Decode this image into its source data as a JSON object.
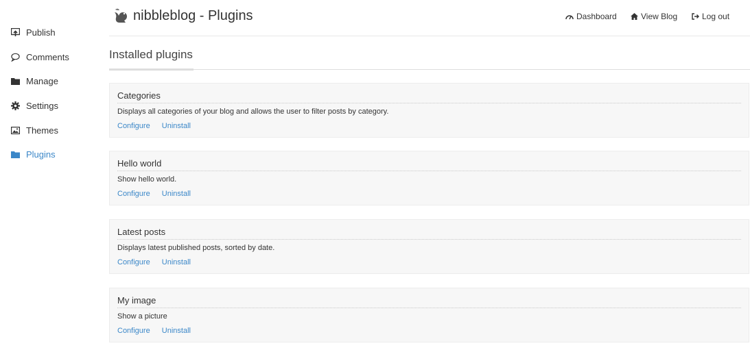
{
  "app": {
    "title": "nibbleblog - Plugins"
  },
  "sidebar": {
    "items": [
      {
        "label": "Publish",
        "icon": "publish-icon"
      },
      {
        "label": "Comments",
        "icon": "comment-icon"
      },
      {
        "label": "Manage",
        "icon": "folder-icon"
      },
      {
        "label": "Settings",
        "icon": "gear-icon"
      },
      {
        "label": "Themes",
        "icon": "image-icon"
      },
      {
        "label": "Plugins",
        "icon": "folder-icon",
        "active": true
      }
    ]
  },
  "topnav": {
    "dashboard": "Dashboard",
    "view_blog": "View Blog",
    "logout": "Log out"
  },
  "section": {
    "title": "Installed plugins"
  },
  "plugins": [
    {
      "name": "Categories",
      "description": "Displays all categories of your blog and allows the user to filter posts by category.",
      "configure": "Configure",
      "uninstall": "Uninstall"
    },
    {
      "name": "Hello world",
      "description": "Show hello world.",
      "configure": "Configure",
      "uninstall": "Uninstall"
    },
    {
      "name": "Latest posts",
      "description": "Displays latest published posts, sorted by date.",
      "configure": "Configure",
      "uninstall": "Uninstall"
    },
    {
      "name": "My image",
      "description": "Show a picture",
      "configure": "Configure",
      "uninstall": "Uninstall"
    }
  ],
  "colors": {
    "accent": "#3b87c8",
    "panel": "#f7f7f7"
  }
}
